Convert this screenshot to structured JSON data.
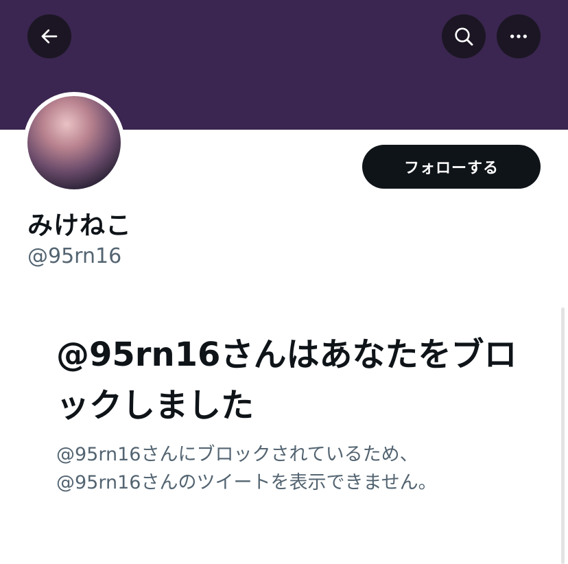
{
  "header": {
    "back_icon": "arrow-left-icon",
    "search_icon": "search-icon",
    "more_icon": "more-horizontal-icon",
    "banner_color": "#3a2650"
  },
  "profile": {
    "display_name": "みけねこ",
    "handle": "@95rn16",
    "follow_label": "フォローする"
  },
  "blocked": {
    "title": "@95rn16さんはあなたをブロックしました",
    "description_line1": "@95rn16さんにブロックされているため、",
    "description_line2": "@95rn16さんのツイートを表示できません。"
  }
}
